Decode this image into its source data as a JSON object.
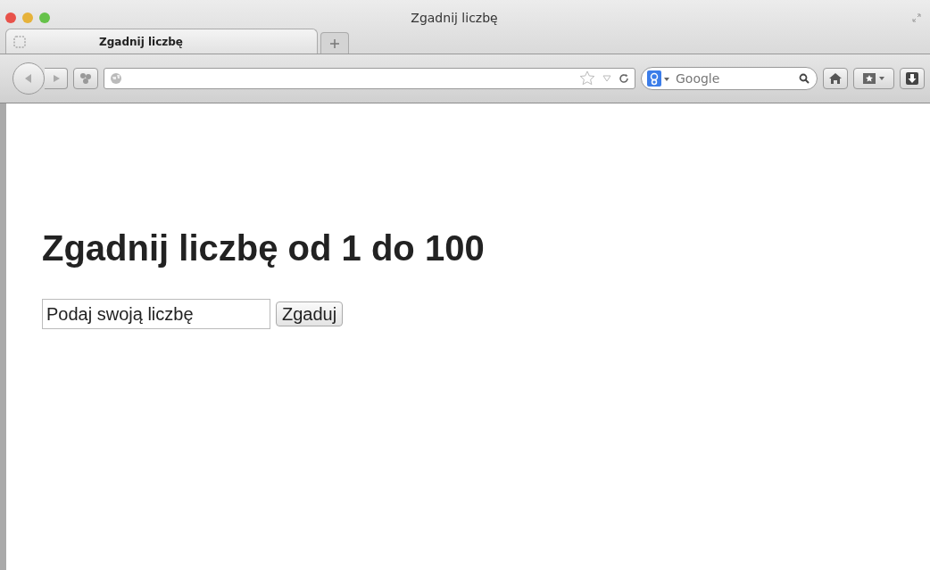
{
  "window": {
    "title": "Zgadnij liczbę"
  },
  "tabs": [
    {
      "label": "Zgadnij liczbę",
      "selected": true
    }
  ],
  "toolbar": {
    "search": {
      "placeholder": "Google"
    }
  },
  "page": {
    "heading": "Zgadnij liczbę od 1 do 100",
    "input": {
      "value": "Podaj swoją liczbę"
    },
    "button": "Zgaduj"
  }
}
